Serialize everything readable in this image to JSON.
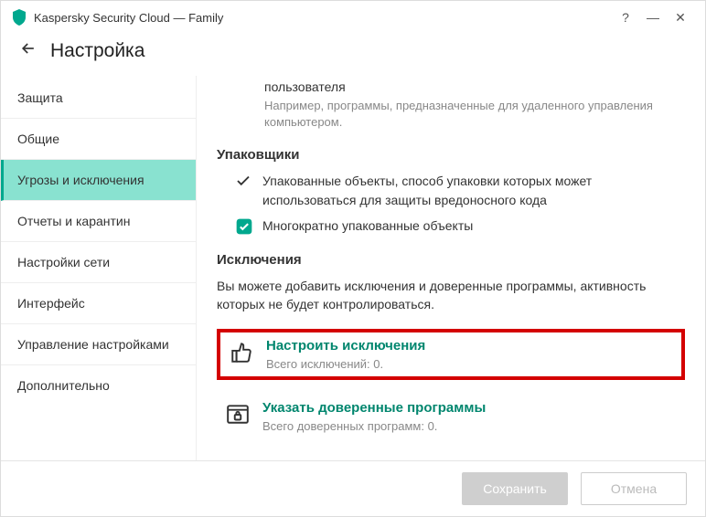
{
  "app": {
    "title": "Kaspersky Security Cloud — Family"
  },
  "page": {
    "title": "Настройка"
  },
  "sidebar": {
    "items": [
      {
        "label": "Защита"
      },
      {
        "label": "Общие"
      },
      {
        "label": "Угрозы и исключения"
      },
      {
        "label": "Отчеты и карантин"
      },
      {
        "label": "Настройки сети"
      },
      {
        "label": "Интерфейс"
      },
      {
        "label": "Управление настройками"
      },
      {
        "label": "Дополнительно"
      }
    ]
  },
  "content": {
    "user_label": "пользователя",
    "user_hint": "Например, программы, предназначенные для удаленного управления компьютером.",
    "packers_title": "Упаковщики",
    "packer1_label": "Упакованные объекты, способ упаковки которых может использоваться для защиты вредоносного кода",
    "packer2_label": "Многократно упакованные объекты",
    "exclusions_title": "Исключения",
    "exclusions_desc": "Вы можете добавить исключения и доверенные программы, активность которых не будет контролироваться.",
    "configure_exclusions": {
      "title": "Настроить исключения",
      "sub": "Всего исключений: 0."
    },
    "trusted_programs": {
      "title": "Указать доверенные программы",
      "sub": "Всего доверенных программ: 0."
    }
  },
  "footer": {
    "save": "Сохранить",
    "cancel": "Отмена"
  }
}
